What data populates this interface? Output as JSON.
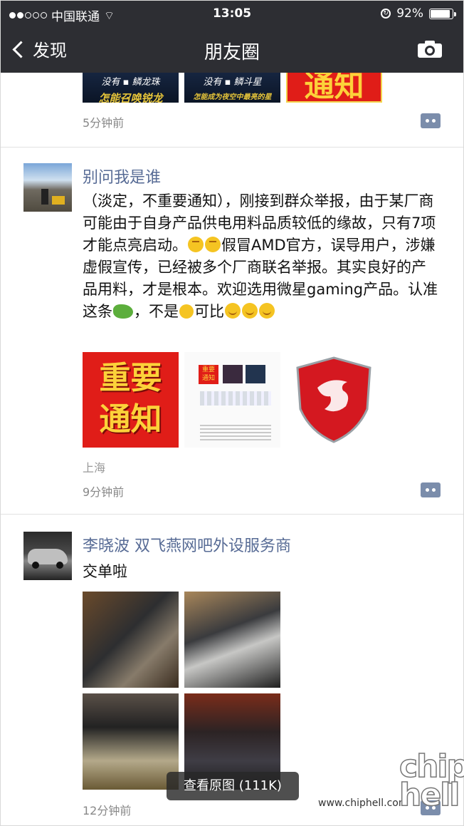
{
  "status_bar": {
    "carrier": "中国联通",
    "time": "13:05",
    "battery": "92%",
    "battery_level": 0.92
  },
  "nav": {
    "back_label": "发现",
    "title": "朋友圈"
  },
  "posts": [
    {
      "time": "5分钟前",
      "images": [
        {
          "caption_top": "没有 ▪ 鳞龙珠",
          "caption_bottom": "怎能召唤锐龙"
        },
        {
          "caption_top": "没有 ▪ 鳞斗星",
          "caption_bottom": "怎能成为夜空中最亮的星"
        },
        {
          "text": "通知"
        }
      ]
    },
    {
      "author": "别问我是谁",
      "text_parts": [
        "（淡定，不重要通知），刚接到群众举报，由于某厂商可能由于自身产品供电用料品质较低的缘故，只有7项才能点亮启动。",
        "假冒AMD官方，误导用户，涉嫌虚假宣传，已经被多个厂商联名举报。其实良好的产品用料，才是根本。欢迎选用微星gaming产品。认准这条",
        "，不是",
        "可比"
      ],
      "images": [
        {
          "text_line1": "重要",
          "text_line2": "通知"
        },
        {
          "mini_tag_1": "重要",
          "mini_tag_2": "通知"
        },
        {
          "alt": "MSI dragon shield"
        }
      ],
      "location": "上海",
      "time": "9分钟前"
    },
    {
      "author": "李晓波  双飞燕网吧外设服务商",
      "text": "交单啦",
      "time": "12分钟前"
    }
  ],
  "toast": "查看原图 (111K)",
  "watermark": {
    "url": "www.chiphell.com",
    "logo_line1": "chip",
    "logo_line2": "hell"
  },
  "colors": {
    "nav_bg": "#2d2e33",
    "name_link": "#576b95",
    "notice_red": "#e01d18",
    "notice_yellow": "#fcd23a"
  }
}
